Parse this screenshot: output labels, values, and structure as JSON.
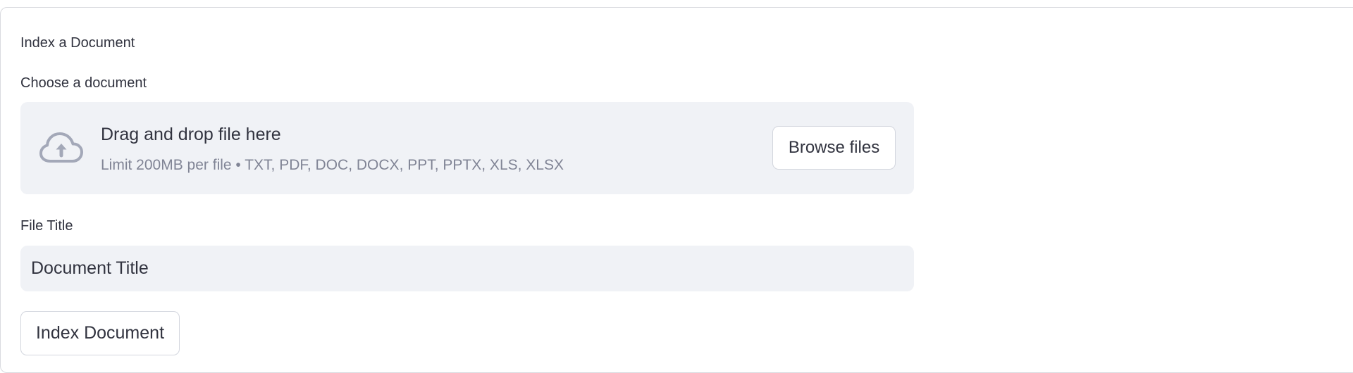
{
  "form": {
    "title": "Index a Document",
    "document_label": "Choose a document",
    "file_title_label": "File Title",
    "submit_label": "Index Document"
  },
  "uploader": {
    "icon": "cloud-upload-icon",
    "drop_text": "Drag and drop file here",
    "limit_text": "Limit 200MB per file • TXT, PDF, DOC, DOCX, PPT, PPTX, XLS, XLSX",
    "browse_label": "Browse files"
  },
  "file_title_input": {
    "value": "",
    "placeholder": "Document Title"
  },
  "colors": {
    "text": "#31333f",
    "muted_text": "#808495",
    "field_background": "#f0f2f6",
    "border": "#d3d6de",
    "icon": "#a3a8b8"
  }
}
